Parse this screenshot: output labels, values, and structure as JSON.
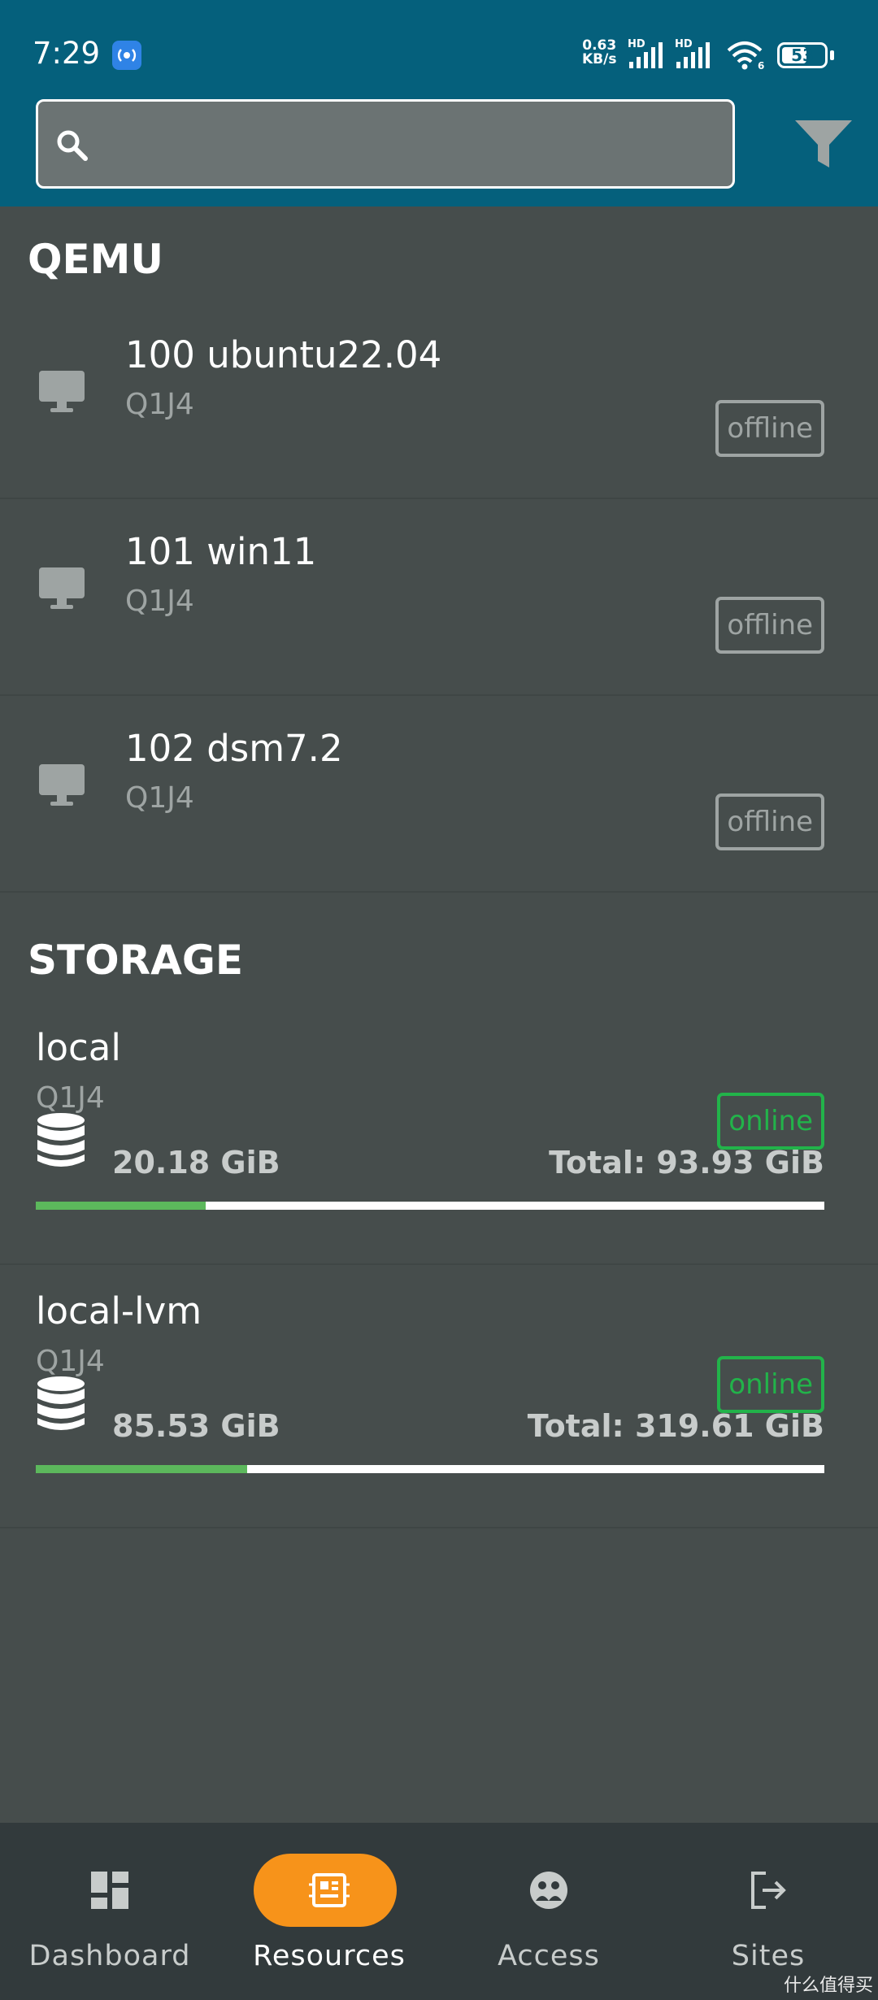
{
  "status_bar": {
    "time": "7:29",
    "net_speed_value": "0.63",
    "net_speed_unit": "KB/s",
    "hd_label": "HD",
    "battery": "53"
  },
  "search": {
    "placeholder": "",
    "value": ""
  },
  "sections": {
    "qemu_title": "QEMU",
    "storage_title": "STORAGE"
  },
  "vms": [
    {
      "name": "100 ubuntu22.04",
      "node": "Q1J4",
      "status": "offline"
    },
    {
      "name": "101 win11",
      "node": "Q1J4",
      "status": "offline"
    },
    {
      "name": "102 dsm7.2",
      "node": "Q1J4",
      "status": "offline"
    }
  ],
  "storage": [
    {
      "name": "local",
      "node": "Q1J4",
      "status": "online",
      "used": "20.18 GiB",
      "total": "Total: 93.93 GiB",
      "usage_fraction": 0.215
    },
    {
      "name": "local-lvm",
      "node": "Q1J4",
      "status": "online",
      "used": "85.53 GiB",
      "total": "Total: 319.61 GiB",
      "usage_fraction": 0.268
    }
  ],
  "nav": {
    "items": [
      {
        "label": "Dashboard",
        "icon": "dashboard-icon",
        "active": false
      },
      {
        "label": "Resources",
        "icon": "resources-icon",
        "active": true
      },
      {
        "label": "Access",
        "icon": "access-icon",
        "active": false
      },
      {
        "label": "Sites",
        "icon": "sites-icon",
        "active": false
      }
    ]
  },
  "watermark": "什么值得买",
  "colors": {
    "header": "#05607c",
    "background": "#464d4c",
    "online": "#22b34a",
    "offline": "#9ea4a3",
    "usage_bar": "#5cb85c",
    "nav_active": "#f7931a"
  }
}
